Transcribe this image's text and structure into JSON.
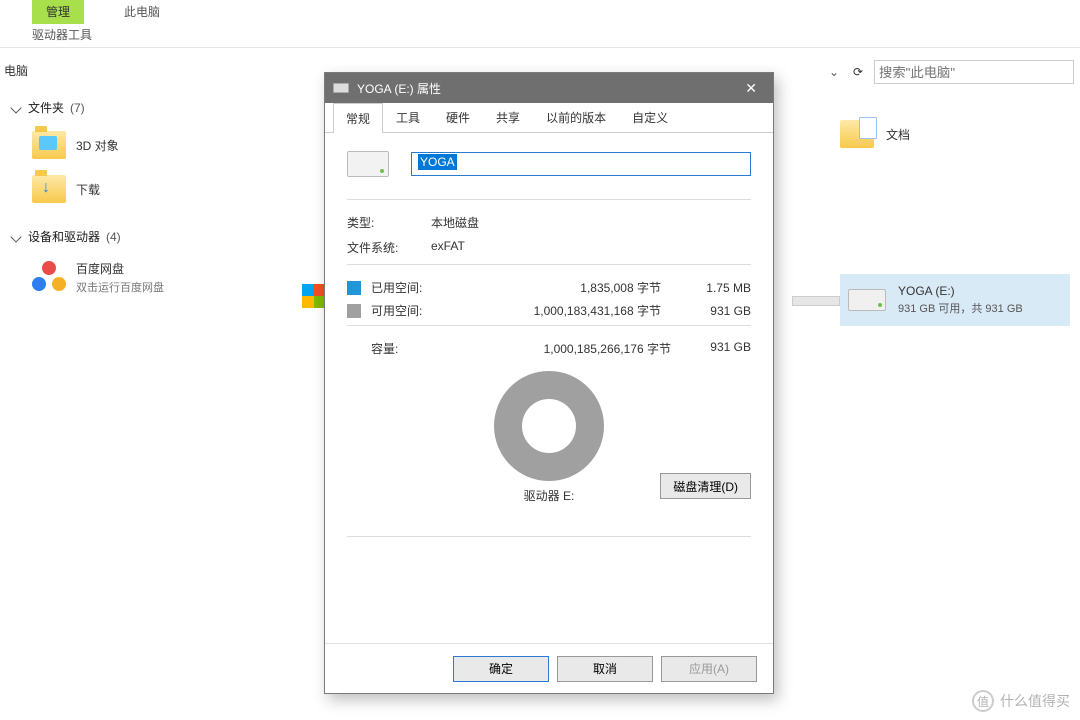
{
  "ribbon": {
    "tab_active": "管理",
    "tab_inactive": "此电脑",
    "subtab": "驱动器工具"
  },
  "pathbar": {
    "location_partial": "电脑",
    "search_placeholder": "搜索\"此电脑\""
  },
  "tree": {
    "groups": [
      {
        "header": "文件夹",
        "count": "(7)",
        "items": [
          {
            "label": "3D 对象",
            "icon": "folder-obj"
          },
          {
            "label": "下载",
            "icon": "folder-dl"
          }
        ]
      },
      {
        "header": "设备和驱动器",
        "count": "(4)",
        "items": [
          {
            "label": "百度网盘",
            "sub": "双击运行百度网盘",
            "icon": "baidu"
          }
        ]
      }
    ]
  },
  "right": {
    "doc_label": "文档",
    "drive": {
      "name": "YOGA (E:)",
      "sub": "931 GB 可用，共 931 GB"
    }
  },
  "dialog": {
    "title": "YOGA (E:) 属性",
    "tabs": [
      "常规",
      "工具",
      "硬件",
      "共享",
      "以前的版本",
      "自定义"
    ],
    "active_tab": 0,
    "name_value": "YOGA",
    "type_label": "类型:",
    "type_value": "本地磁盘",
    "fs_label": "文件系统:",
    "fs_value": "exFAT",
    "used_label": "已用空间:",
    "used_bytes": "1,835,008 字节",
    "used_hr": "1.75 MB",
    "free_label": "可用空间:",
    "free_bytes": "1,000,183,431,168 字节",
    "free_hr": "931 GB",
    "cap_label": "容量:",
    "cap_bytes": "1,000,185,266,176 字节",
    "cap_hr": "931 GB",
    "drive_label": "驱动器 E:",
    "cleanup_btn": "磁盘清理(D)",
    "ok": "确定",
    "cancel": "取消",
    "apply": "应用(A)"
  },
  "watermark": {
    "text": "什么值得买",
    "badge": "值"
  },
  "chart_data": {
    "type": "pie",
    "title": "驱动器 E:",
    "series": [
      {
        "name": "已用空间",
        "value": 1835008,
        "unit": "字节",
        "hr": "1.75 MB",
        "color": "#2196d6"
      },
      {
        "name": "可用空间",
        "value": 1000183431168,
        "unit": "字节",
        "hr": "931 GB",
        "color": "#a0a0a0"
      }
    ],
    "total": {
      "label": "容量",
      "value": 1000185266176,
      "unit": "字节",
      "hr": "931 GB"
    }
  }
}
